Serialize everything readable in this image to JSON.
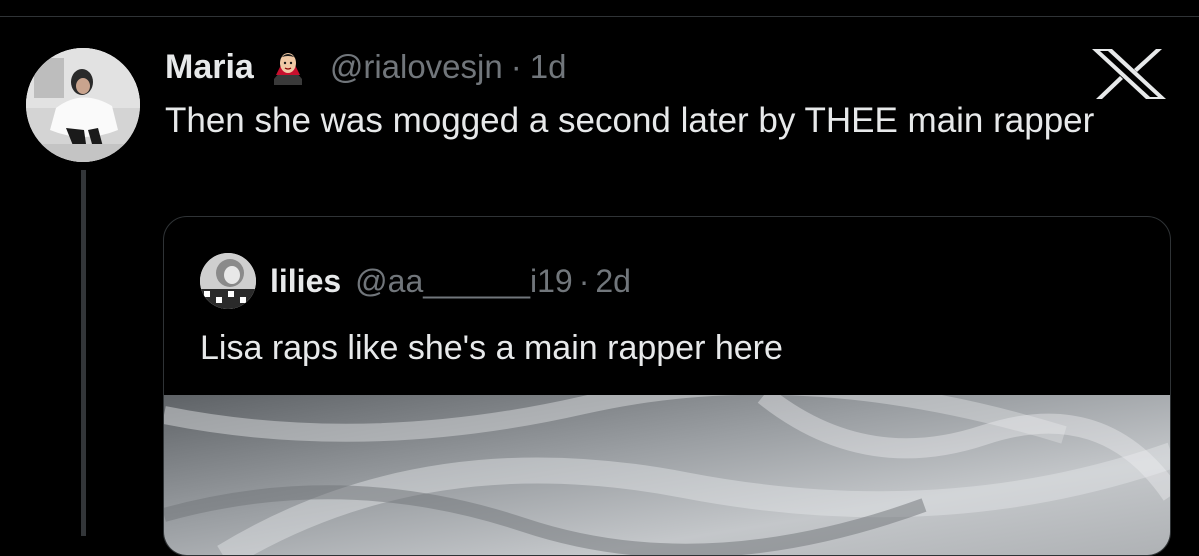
{
  "tweet": {
    "display_name": "Maria",
    "emoji_icon": "vampire-emoji-icon",
    "handle": "@rialovesjn",
    "separator": "·",
    "time": "1d",
    "text": "Then she was mogged a second later by THEE main rapper"
  },
  "brand": {
    "logo_icon": "x-logo-icon"
  },
  "quote": {
    "display_name": "lilies",
    "handle": "@aa______i19",
    "separator": "·",
    "time": "2d",
    "text": "Lisa raps like she's a main rapper here",
    "media_icon": "video-thumbnail"
  },
  "colors": {
    "background": "#000000",
    "primary_text": "#e7e9ea",
    "secondary_text": "#71767b",
    "border": "#2f3336"
  }
}
